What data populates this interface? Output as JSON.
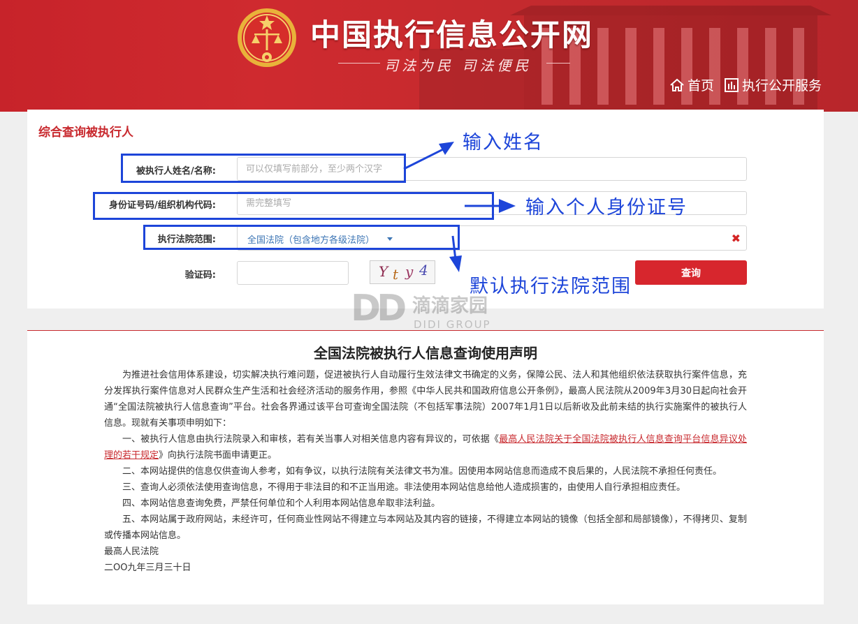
{
  "header": {
    "site_title": "中国执行信息公开网",
    "slogan": "司法为民  司法便民",
    "nav": [
      {
        "label": "首页"
      },
      {
        "label": "执行公开服务"
      }
    ]
  },
  "search": {
    "title": "综合查询被执行人",
    "name_label": "被执行人姓名/名称:",
    "name_placeholder": "可以仅填写前部分，至少两个汉字",
    "id_label": "身份证号码/组织机构代码:",
    "id_placeholder": "需完整填写",
    "court_label": "执行法院范围:",
    "court_value": "全国法院（包含地方各级法院）",
    "captcha_label": "验证码:",
    "captcha_text": "Y t y 4",
    "query_button": "查询"
  },
  "annotations": {
    "name": "输入姓名",
    "id": "输入个人身份证号",
    "court": "默认执行法院范围"
  },
  "watermark": {
    "logo": "DD",
    "cn": "滴滴家园",
    "en": "DIDI GROUP"
  },
  "notice": {
    "title": "全国法院被执行人信息查询使用声明",
    "p1": "为推进社会信用体系建设，切实解决执行难问题，促进被执行人自动履行生效法律文书确定的义务，保障公民、法人和其他组织依法获取执行案件信息，充分发挥执行案件信息对人民群众生产生活和社会经济活动的服务作用，参照《中华人民共和国政府信息公开条例》，最高人民法院从2009年3月30日起向社会开通“全国法院被执行人信息查询”平台。社会各界通过该平台可查询全国法院（不包括军事法院）2007年1月1日以后新收及此前未结的执行实施案件的被执行人信息。现就有关事项申明如下：",
    "p2_before": "一、被执行人信息由执行法院录入和审核，若有关当事人对相关信息内容有异议的，可依据《",
    "p2_link": "最高人民法院关于全国法院被执行人信息查询平台信息异议处理的若干规定",
    "p2_after": "》向执行法院书面申请更正。",
    "p3": "二、本网站提供的信息仅供查询人参考，如有争议，以执行法院有关法律文书为准。因使用本网站信息而造成不良后果的，人民法院不承担任何责任。",
    "p4": "三、查询人必须依法使用查询信息，不得用于非法目的和不正当用途。非法使用本网站信息给他人造成损害的，由使用人自行承担相应责任。",
    "p5": "四、本网站信息查询免费，严禁任何单位和个人利用本网站信息牟取非法利益。",
    "p6": "五、本网站属于政府网站，未经许可，任何商业性网站不得建立与本网站及其内容的链接，不得建立本网站的镜像（包括全部和局部镜像），不得拷贝、复制或传播本网站信息。",
    "signer": "最高人民法院",
    "date": "二OO九年三月三十日"
  }
}
